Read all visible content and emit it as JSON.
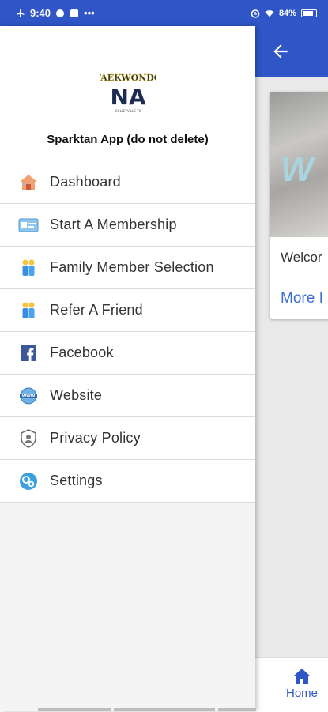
{
  "status_bar": {
    "time": "9:40",
    "dots": "•••",
    "battery": "84%"
  },
  "drawer": {
    "app_name": "Sparktan App (do not delete)",
    "logo_text_top": "TAEKWONDO",
    "logo_text_main": "NA",
    "logo_text_bottom": "COLLEYVILLE TX",
    "items": [
      {
        "label": "Dashboard",
        "icon": "house-icon"
      },
      {
        "label": "Start A Membership",
        "icon": "membership-card-icon"
      },
      {
        "label": "Family Member Selection",
        "icon": "family-icon"
      },
      {
        "label": "Refer A Friend",
        "icon": "refer-friend-icon"
      },
      {
        "label": "Facebook",
        "icon": "facebook-icon"
      },
      {
        "label": "Website",
        "icon": "www-globe-icon"
      },
      {
        "label": "Privacy Policy",
        "icon": "shield-icon"
      },
      {
        "label": "Settings",
        "icon": "gear-icon"
      }
    ]
  },
  "background": {
    "card_image_text": "W",
    "card_welcome": "Welcor",
    "card_more": "More I",
    "bottom_nav": {
      "home_label": "Home"
    }
  },
  "colors": {
    "primary": "#2f55c7",
    "link": "#3b6fd6"
  }
}
